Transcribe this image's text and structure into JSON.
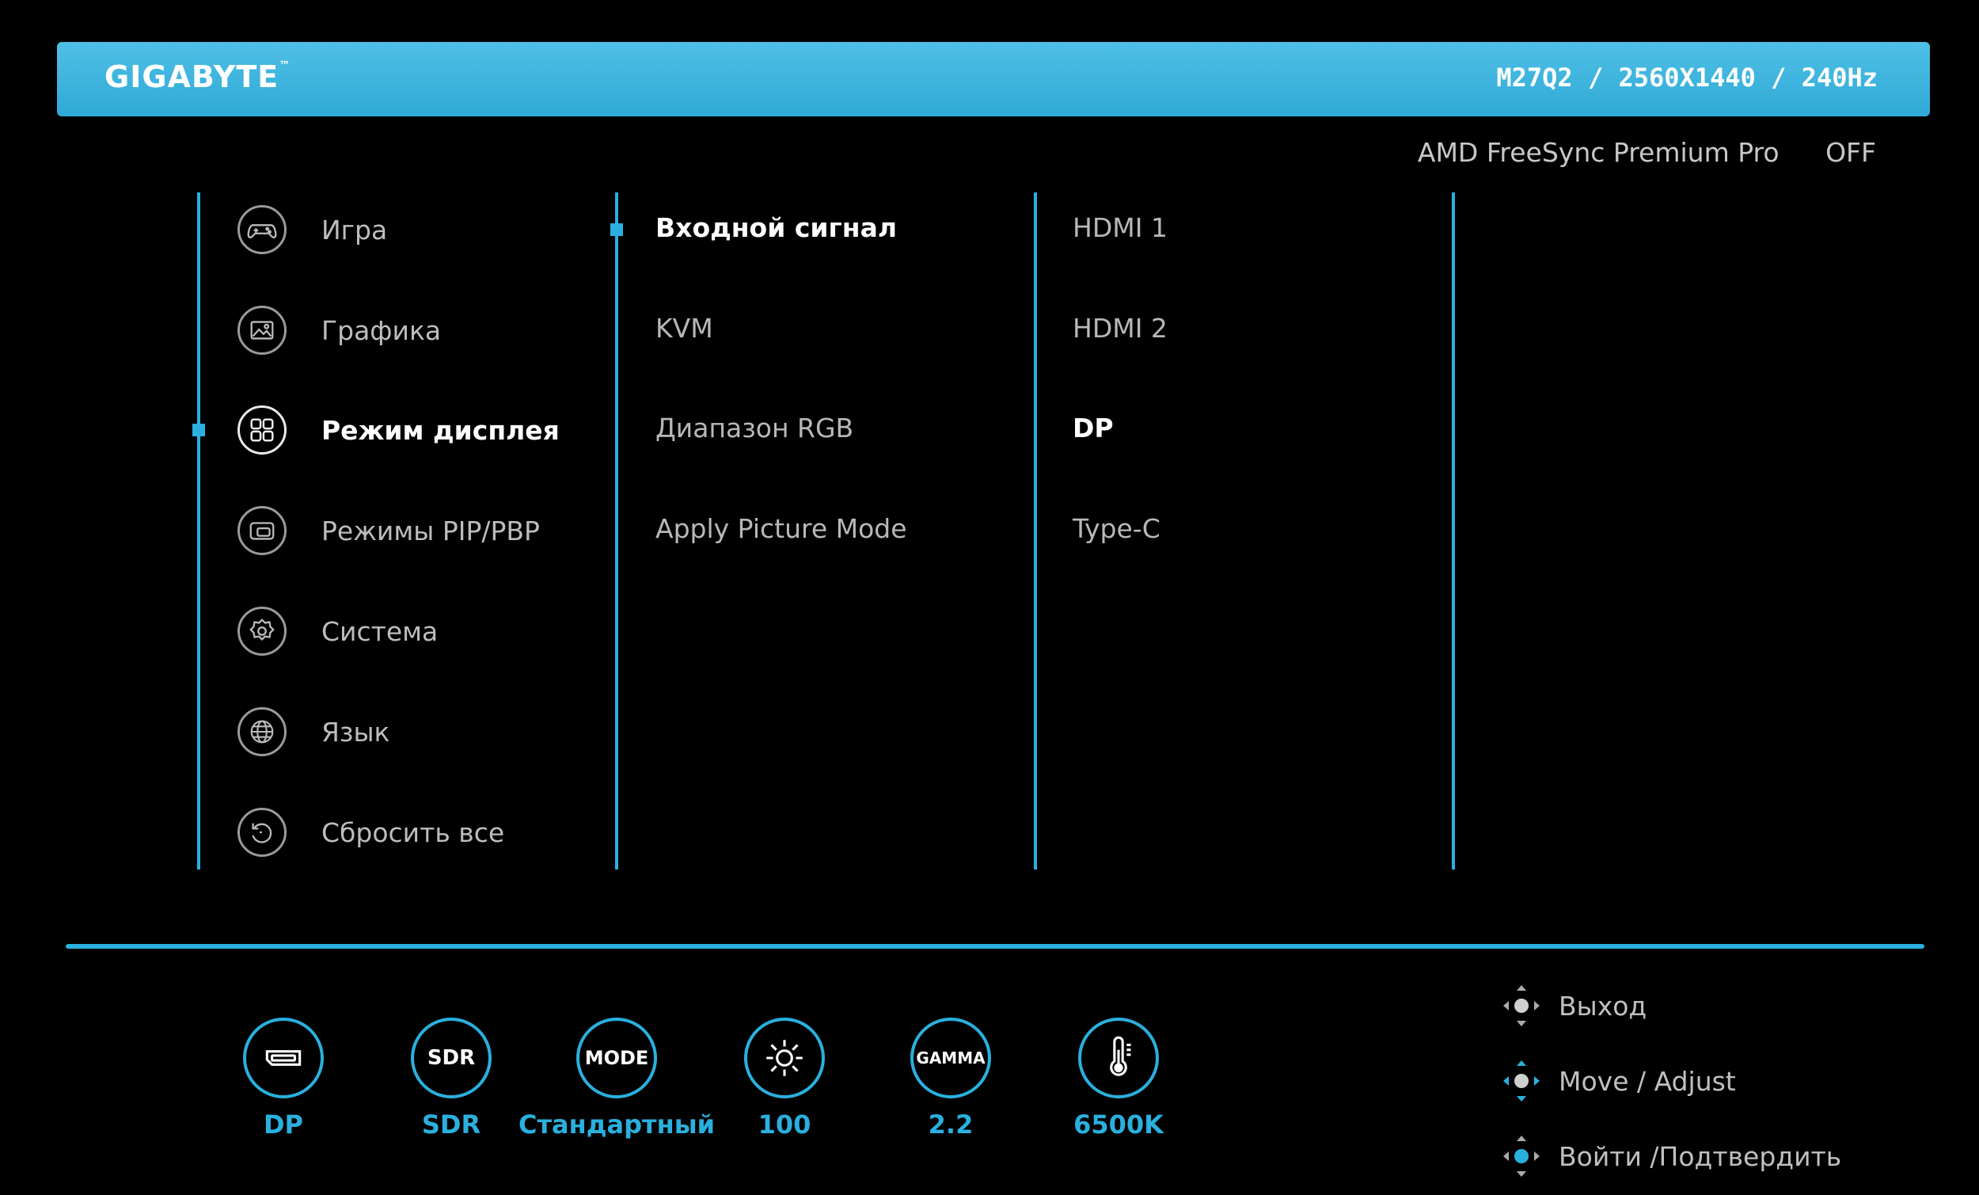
{
  "header": {
    "brand": "GIGABYTE",
    "trademark": "™",
    "model_info": "M27Q2  /  2560X1440  / 240Hz"
  },
  "freesync": {
    "label": "AMD FreeSync Premium Pro",
    "value": "OFF"
  },
  "main_menu": {
    "items": [
      {
        "label": "Игра",
        "icon": "gamepad-icon"
      },
      {
        "label": "Графика",
        "icon": "picture-icon"
      },
      {
        "label": "Режим дисплея",
        "icon": "display-mode-icon"
      },
      {
        "label": "Режимы PIP/PBP",
        "icon": "pip-icon"
      },
      {
        "label": "Система",
        "icon": "gear-icon"
      },
      {
        "label": "Язык",
        "icon": "globe-icon"
      },
      {
        "label": "Сбросить все",
        "icon": "reset-icon"
      }
    ],
    "active_index": 2
  },
  "sub_menu": {
    "items": [
      "Входной сигнал",
      "KVM",
      "Диапазон  RGB",
      "Apply Picture Mode"
    ],
    "active_index": 0
  },
  "options": {
    "items": [
      "HDMI 1",
      "HDMI 2",
      "DP",
      "Type-C"
    ],
    "selected_index": 2
  },
  "status_bar": [
    {
      "icon": "dp-port-icon",
      "label": "DP"
    },
    {
      "icon": "sdr-icon",
      "icon_text": "SDR",
      "label": "SDR"
    },
    {
      "icon": "mode-icon",
      "icon_text": "MODE",
      "label": "Стандартный"
    },
    {
      "icon": "brightness-icon",
      "label": "100"
    },
    {
      "icon": "gamma-icon",
      "icon_text": "GAMMA",
      "label": "2.2"
    },
    {
      "icon": "thermometer-icon",
      "label": "6500K"
    }
  ],
  "hints": [
    {
      "icon": "joystick-press-icon",
      "label": "Выход"
    },
    {
      "icon": "joystick-move-icon",
      "label": "Move / Adjust"
    },
    {
      "icon": "joystick-enter-icon",
      "label": "Войти /Подтвердить"
    }
  ],
  "colors": {
    "accent": "#2ab0de",
    "header": "#3fb5e0",
    "background": "#000000"
  }
}
